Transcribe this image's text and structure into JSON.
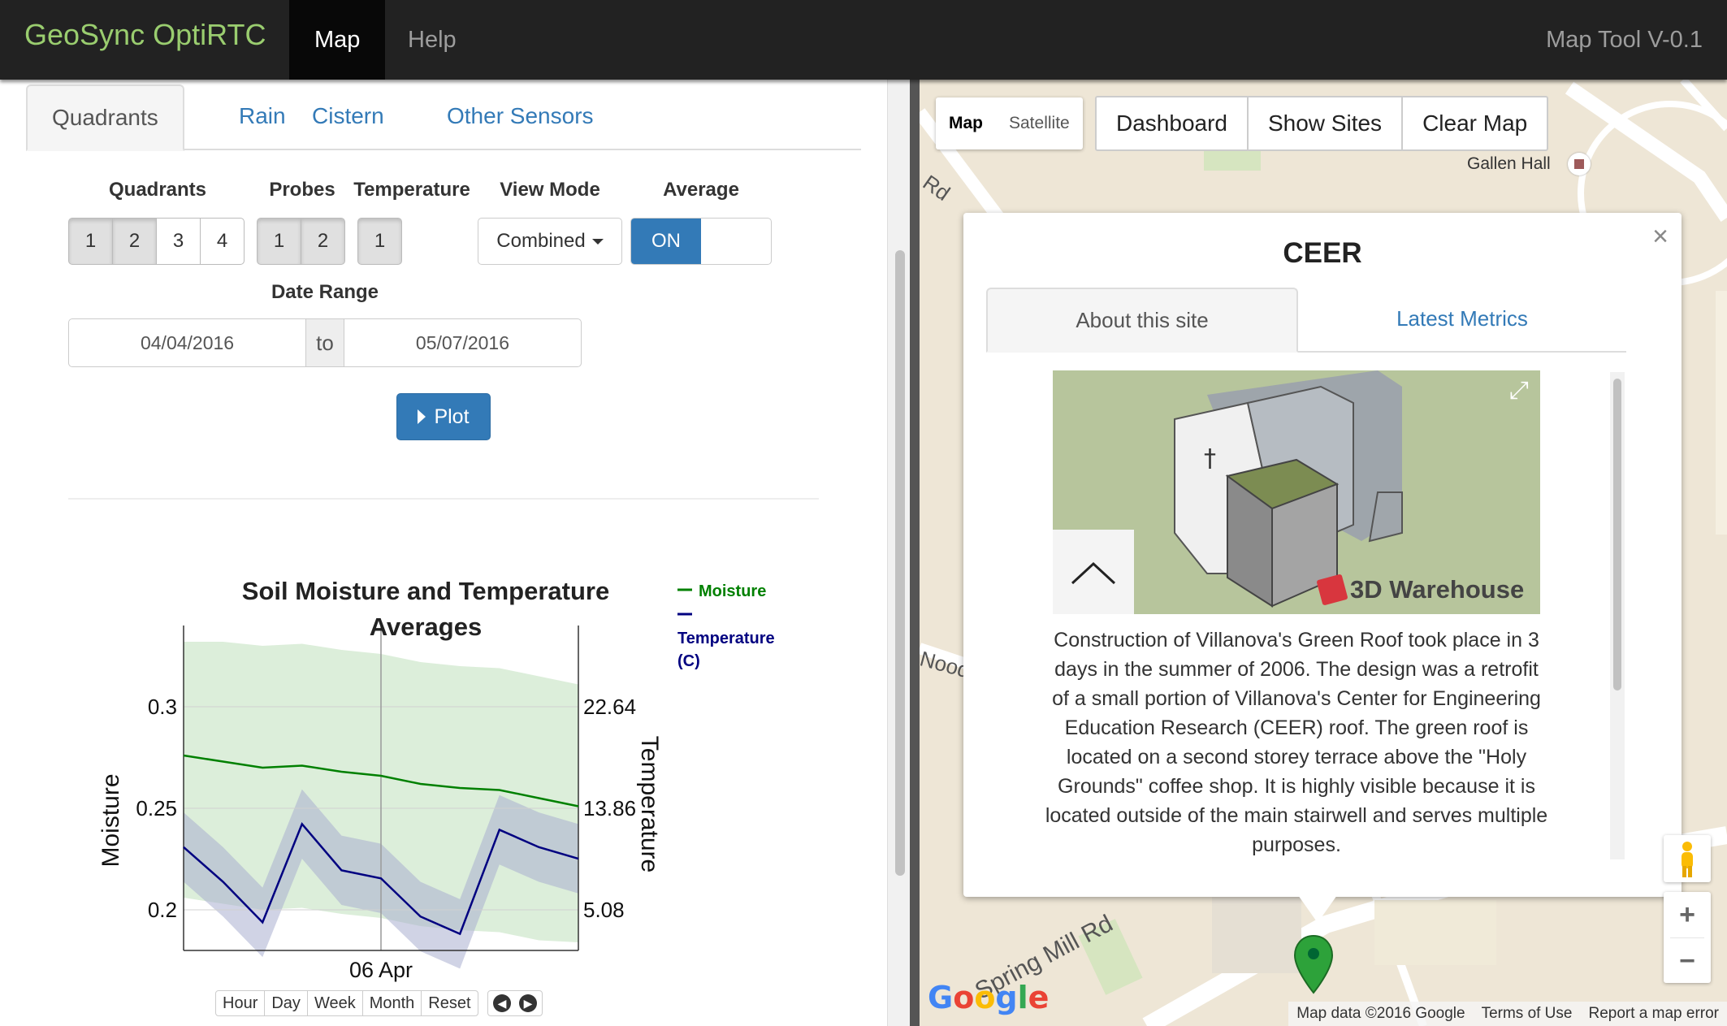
{
  "navbar": {
    "brand": "GeoSync OptiRTC",
    "links": [
      "Map",
      "Help"
    ],
    "right_text": "Map Tool V-0.1"
  },
  "left_tabs": [
    "Quadrants",
    "Rain",
    "Cistern",
    "Other Sensors"
  ],
  "controls": {
    "quadrants_label": "Quadrants",
    "quadrants": [
      "1",
      "2",
      "3",
      "4"
    ],
    "probes_label": "Probes",
    "probes": [
      "1",
      "2"
    ],
    "temperature_label": "Temperature",
    "temperature": [
      "1"
    ],
    "view_mode_label": "View Mode",
    "view_mode_value": "Combined",
    "average_label": "Average",
    "average_value": "ON",
    "date_range_label": "Date Range",
    "date_from": "04/04/2016",
    "date_to_word": "to",
    "date_to": "05/07/2016",
    "plot_label": "Plot"
  },
  "chart_data": {
    "type": "line",
    "title": "Soil Moisture and Temperature Averages",
    "xlabel": "06 Apr",
    "ylabel": "Moisture",
    "y2label": "Temperature",
    "y_ticks": [
      "0.3",
      "0.25",
      "0.2"
    ],
    "y2_ticks": [
      "22.64",
      "13.86",
      "5.08"
    ],
    "ylim": [
      0.18,
      0.34
    ],
    "legend": [
      {
        "name": "Moisture",
        "color": "#008000"
      },
      {
        "name": "Temperature (C)",
        "color": "#000080"
      }
    ],
    "x": [
      0,
      0.1,
      0.2,
      0.3,
      0.4,
      0.5,
      0.6,
      0.7,
      0.8,
      0.9,
      1.0
    ],
    "series": [
      {
        "name": "Moisture",
        "axis": "left",
        "values": [
          0.276,
          0.273,
          0.27,
          0.271,
          0.268,
          0.266,
          0.262,
          0.26,
          0.259,
          0.255,
          0.251
        ]
      },
      {
        "name": "Temperature (C)",
        "axis": "right",
        "values": [
          10.5,
          7.5,
          4.0,
          12.5,
          8.5,
          7.8,
          4.5,
          3.0,
          12.0,
          10.5,
          9.5
        ]
      }
    ],
    "range_buttons": [
      "Hour",
      "Day",
      "Week",
      "Month",
      "Reset"
    ]
  },
  "map": {
    "map_types": [
      "Map",
      "Satellite"
    ],
    "buttons": [
      "Dashboard",
      "Show Sites",
      "Clear Map"
    ],
    "place_label": "Gallen Hall",
    "road_label": "Spring Mill Rd",
    "attribution": [
      "Map data ©2016 Google",
      "Terms of Use",
      "Report a map error"
    ],
    "google_logo": "Google"
  },
  "popup": {
    "title": "CEER",
    "tabs": [
      "About this site",
      "Latest Metrics"
    ],
    "watermark": "3D Warehouse",
    "description": "Construction of Villanova's Green Roof took place in 3 days in the summer of 2006. The design was a retrofit of a small portion of Villanova's Center for Engineering Education Research (CEER) roof. The green roof is located on a second storey terrace above the \"Holy Grounds\" coffee shop. It is highly visible because it is located outside of the main stairwell and serves multiple purposes.",
    "close": "×"
  },
  "colors": {
    "accent": "#337ab7",
    "brand": "#9acd6f",
    "moisture": "#008000",
    "temperature": "#000080"
  }
}
